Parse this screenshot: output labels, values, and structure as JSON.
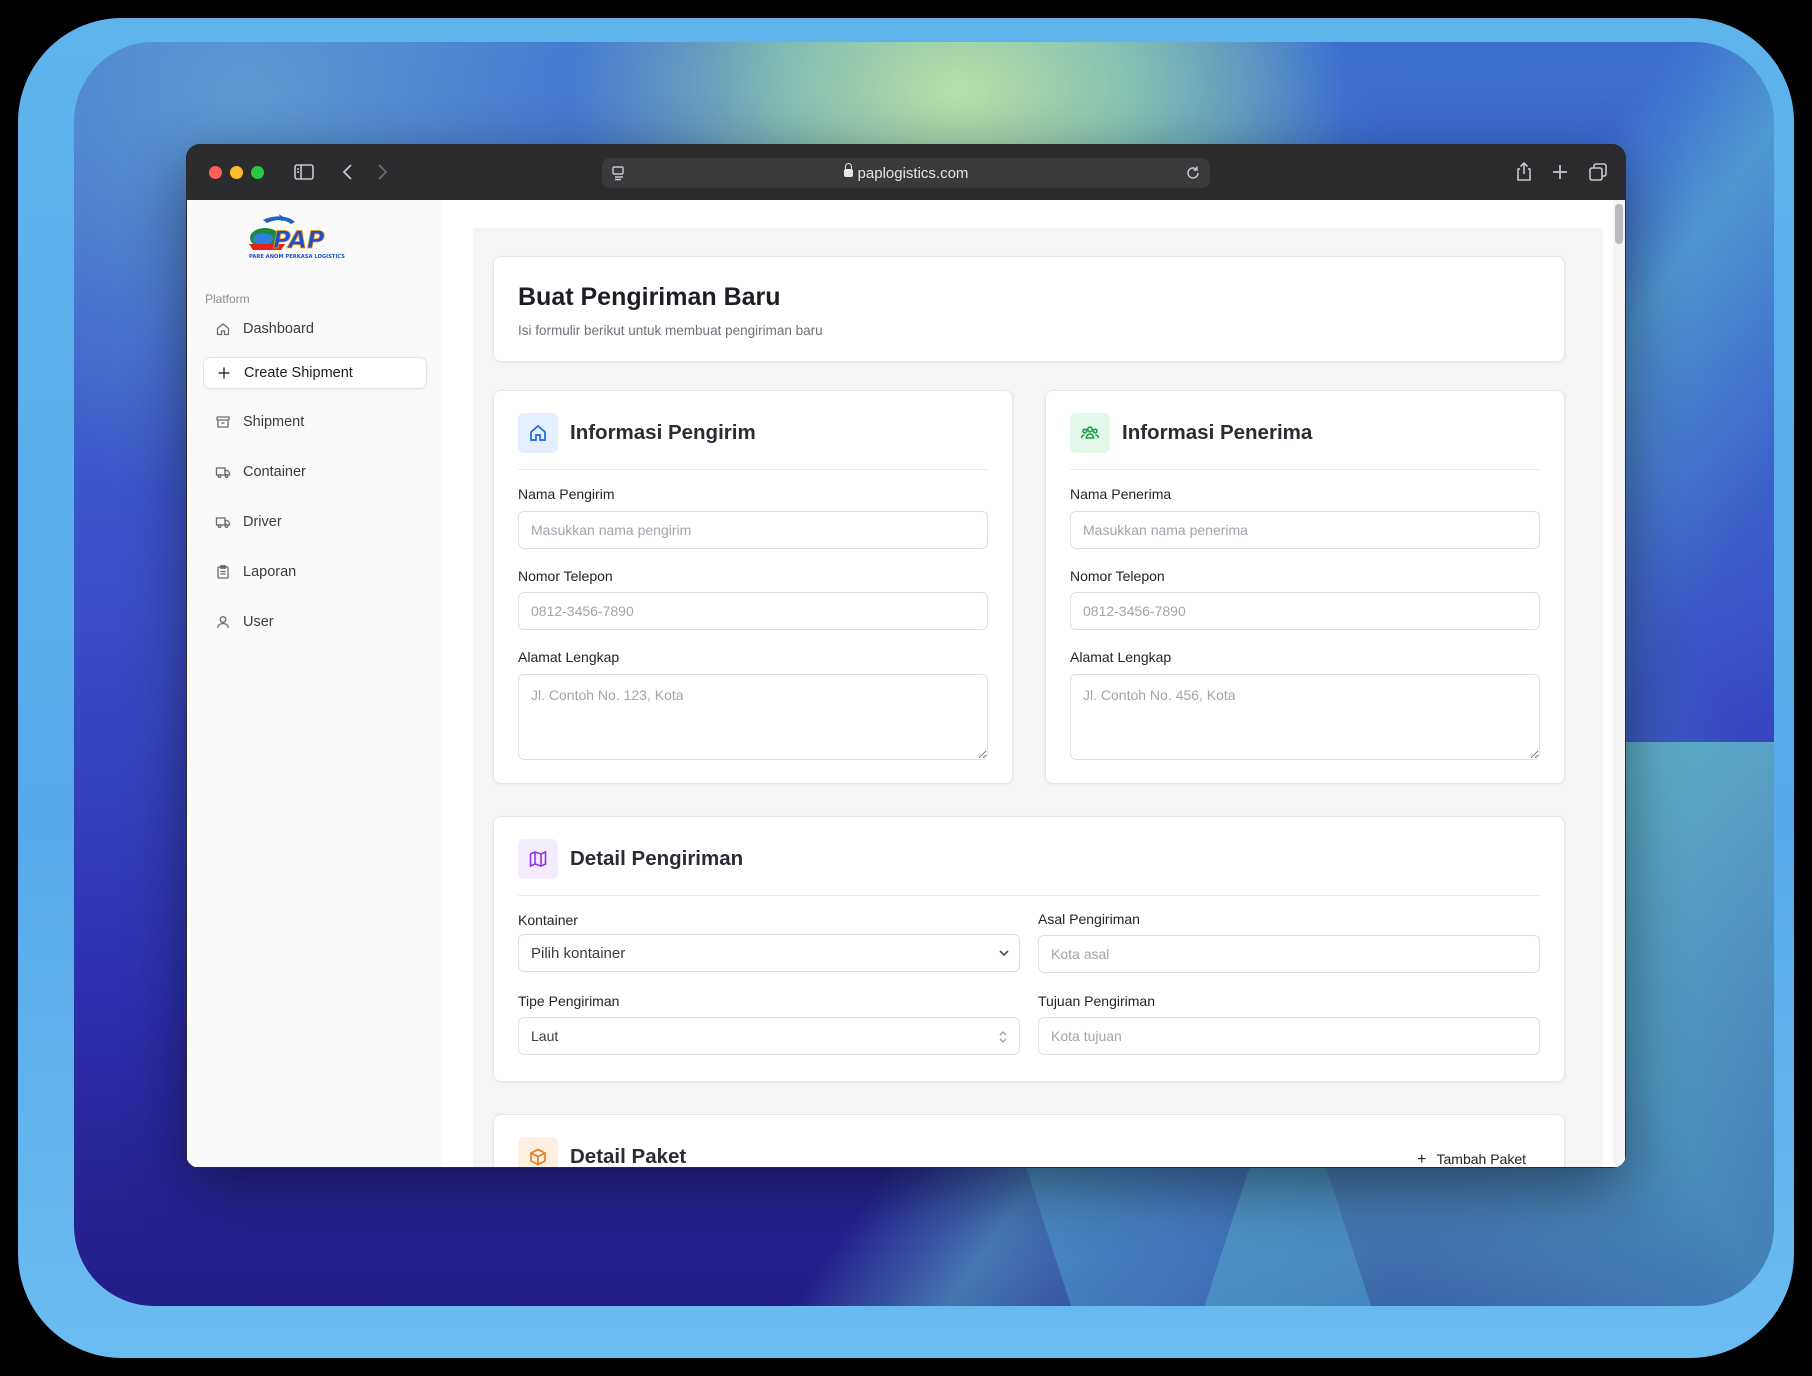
{
  "browser": {
    "url": "paplogistics.com"
  },
  "logo": {
    "text": "PAP",
    "tagline": "PARE ANOM PERKASA LOGISTICS"
  },
  "sidebar": {
    "section_label": "Platform",
    "items": [
      {
        "label": "Dashboard",
        "icon": "home-icon"
      },
      {
        "label": "Create Shipment",
        "icon": "plus-icon"
      },
      {
        "label": "Shipment",
        "icon": "archive-icon"
      },
      {
        "label": "Container",
        "icon": "truck-icon"
      },
      {
        "label": "Driver",
        "icon": "truck-icon"
      },
      {
        "label": "Laporan",
        "icon": "clipboard-icon"
      },
      {
        "label": "User",
        "icon": "user-icon"
      }
    ]
  },
  "header": {
    "title": "Buat Pengiriman Baru",
    "subtitle": "Isi formulir berikut untuk membuat pengiriman baru"
  },
  "sender": {
    "title": "Informasi Pengirim",
    "name_label": "Nama Pengirim",
    "name_placeholder": "Masukkan nama pengirim",
    "phone_label": "Nomor Telepon",
    "phone_placeholder": "0812-3456-7890",
    "address_label": "Alamat Lengkap",
    "address_placeholder": "Jl. Contoh No. 123, Kota"
  },
  "receiver": {
    "title": "Informasi Penerima",
    "name_label": "Nama Penerima",
    "name_placeholder": "Masukkan nama penerima",
    "phone_label": "Nomor Telepon",
    "phone_placeholder": "0812-3456-7890",
    "address_label": "Alamat Lengkap",
    "address_placeholder": "Jl. Contoh No. 456, Kota"
  },
  "shipment": {
    "title": "Detail Pengiriman",
    "container_label": "Kontainer",
    "container_value": "Pilih kontainer",
    "origin_label": "Asal Pengiriman",
    "origin_placeholder": "Kota asal",
    "type_label": "Tipe Pengiriman",
    "type_value": "Laut",
    "destination_label": "Tujuan Pengiriman",
    "destination_placeholder": "Kota tujuan"
  },
  "package": {
    "title": "Detail Paket",
    "add_label": "Tambah Paket"
  },
  "colors": {
    "sender_icon_bg": "#e6efff",
    "sender_icon": "#2563eb",
    "receiver_icon_bg": "#e3f6ea",
    "receiver_icon": "#16a34a",
    "shipment_icon_bg": "#f3ecfb",
    "shipment_icon": "#9333ea",
    "package_icon_bg": "#fdf0e2",
    "package_icon": "#ea7a17"
  }
}
